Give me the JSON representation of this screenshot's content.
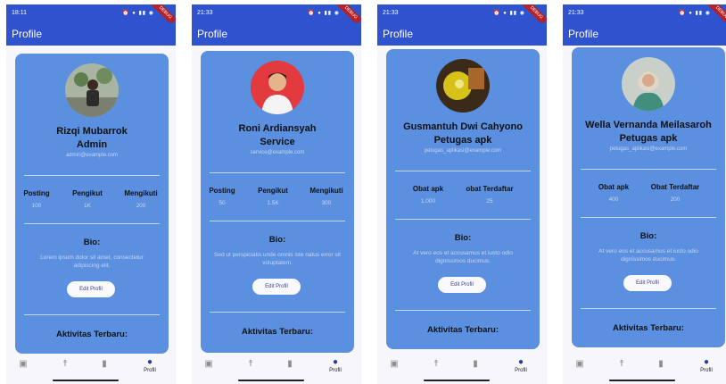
{
  "screens": [
    {
      "status_time": "18:11",
      "title": "Profile",
      "name_line1": "Rizqi Mubarrok",
      "name_line2": "Admin",
      "email": "admin@example.com",
      "stats": [
        {
          "label": "Posting",
          "value": "100"
        },
        {
          "label": "Pengikut",
          "value": "1K"
        },
        {
          "label": "Mengikuti",
          "value": "200"
        }
      ],
      "bio_heading": "Bio:",
      "bio_text": "Lorem ipsum dolor sit amet, consectetur adipiscing elit.",
      "edit_label": "Edit Profil",
      "activity_heading": "Aktivitas Terbaru:",
      "nav_label": "Profil"
    },
    {
      "status_time": "21:33",
      "title": "Profile",
      "name_line1": "Roni Ardiansyah",
      "name_line2": "Service",
      "email": "service@example.com",
      "stats": [
        {
          "label": "Posting",
          "value": "50"
        },
        {
          "label": "Pengikut",
          "value": "1.5K"
        },
        {
          "label": "Mengikuti",
          "value": "300"
        }
      ],
      "bio_heading": "Bio:",
      "bio_text": "Sed ut perspiciatis unde omnis iste natus error sit voluptatem.",
      "edit_label": "Edit Profil",
      "activity_heading": "Aktivitas Terbaru:",
      "nav_label": "Profil"
    },
    {
      "status_time": "21:33",
      "title": "Profile",
      "name_line1": "Gusmantuh Dwi Cahyono",
      "name_line2": "Petugas apk",
      "email": "petugas_aplikasi@example.com",
      "stats": [
        {
          "label": "Obat apk",
          "value": "1.000"
        },
        {
          "label": "obat Terdaftar",
          "value": "25"
        }
      ],
      "bio_heading": "Bio:",
      "bio_text": "At vero eos et accusamus et iusto odio dignissimos ducimus.",
      "edit_label": "Edit Profil",
      "activity_heading": "Aktivitas Terbaru:",
      "nav_label": "Profil"
    },
    {
      "status_time": "21:33",
      "title": "Profile",
      "name_line1": "Wella Vernanda Meilasaroh",
      "name_line2": "Petugas apk",
      "email": "petugas_aplikasi@example.com",
      "stats": [
        {
          "label": "Obat apk",
          "value": "400"
        },
        {
          "label": "Obat Terdaftar",
          "value": "200"
        }
      ],
      "bio_heading": "Bio:",
      "bio_text": "At vero eos et accusamus et iusto odio dignissimos ducimus.",
      "edit_label": "Edit Profil",
      "activity_heading": "Aktivitas Terbaru:",
      "nav_label": "Profil"
    }
  ],
  "ribbon_text": "DEBUG",
  "icons": {
    "nav": [
      "add-note-icon",
      "accessibility-icon",
      "bookmark-icon",
      "person-icon"
    ],
    "status": [
      "alarm-icon",
      "notification-icon",
      "signal-icon",
      "wifi-icon",
      "battery-icon"
    ]
  },
  "colors": {
    "appbar": "#2f52cf",
    "card": "#5b8fe0",
    "nav_active": "#1f3e9e"
  }
}
